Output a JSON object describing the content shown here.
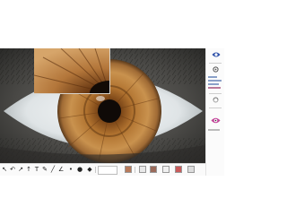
{
  "app": {
    "toolbar": {
      "tools": [
        {
          "name": "pointer-tool-icon",
          "glyph": "↖"
        },
        {
          "name": "undo-icon",
          "glyph": "↶"
        },
        {
          "name": "arrow-tool-icon",
          "glyph": "↗"
        },
        {
          "name": "arrow-up-tool-icon",
          "glyph": "↑"
        },
        {
          "name": "text-tool-icon",
          "glyph": "T"
        },
        {
          "name": "pen-tool-icon",
          "glyph": "✎"
        },
        {
          "name": "line-tool-icon",
          "glyph": "╱"
        },
        {
          "name": "angle-tool-icon",
          "glyph": "∠"
        },
        {
          "name": "small-dot-icon",
          "glyph": "•"
        },
        {
          "name": "large-dot-icon",
          "glyph": "●"
        },
        {
          "name": "fill-tool-icon",
          "glyph": "◆"
        }
      ],
      "fields": [
        "",
        ""
      ]
    },
    "side_panel": {
      "icons": [
        "eye-icon",
        "settings-icon",
        "sync-icon",
        "lens-icon"
      ]
    },
    "colors": {
      "accent": "#2b4ea8",
      "iris": "#a8692a",
      "sclera": "#e8ecee"
    }
  }
}
